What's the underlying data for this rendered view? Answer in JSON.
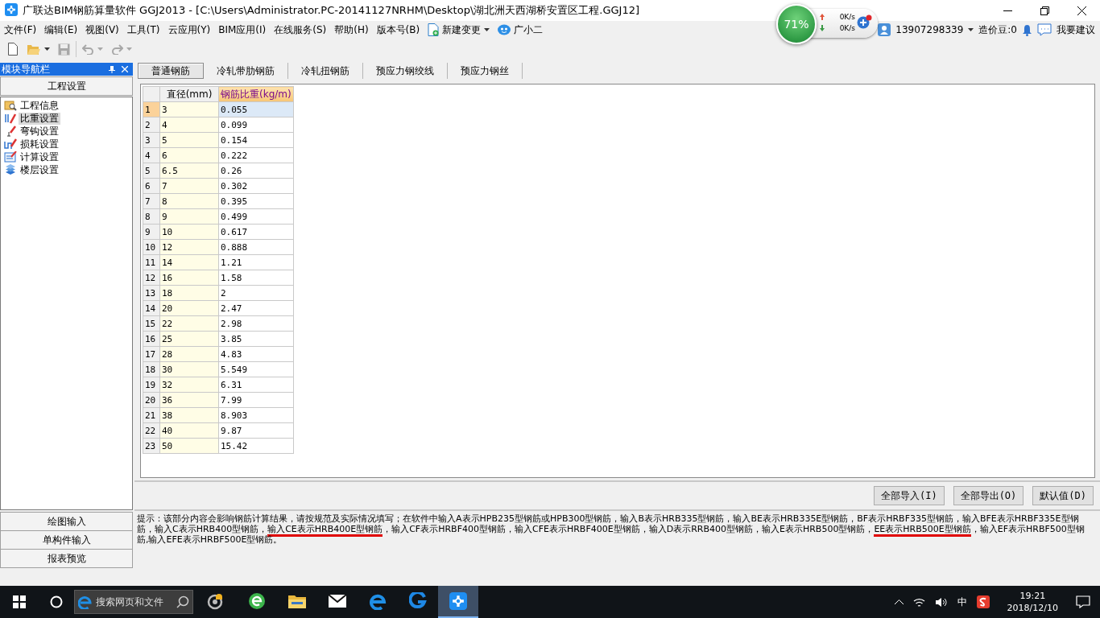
{
  "window": {
    "title": "广联达BIM钢筋算量软件 GGJ2013 - [C:\\Users\\Administrator.PC-20141127NRHM\\Desktop\\湖北洲天西湖桥安置区工程.GGJ12]"
  },
  "monitor": {
    "percent": "71%",
    "upload": "0K/s",
    "download": "0K/s"
  },
  "menu": [
    "文件(F)",
    "编辑(E)",
    "视图(V)",
    "工具(T)",
    "云应用(Y)",
    "BIM应用(I)",
    "在线服务(S)",
    "帮助(H)",
    "版本号(B)"
  ],
  "menu_extras": [
    {
      "label": "新建变更",
      "kind": "document"
    },
    {
      "label": "广小二",
      "kind": "mascot"
    }
  ],
  "account": {
    "phone": "13907298339",
    "beans": "造价豆:0",
    "feedback": "我要建议"
  },
  "toolbar": [
    {
      "kind": "new",
      "disabled": false,
      "dropdown": false
    },
    {
      "kind": "open",
      "disabled": false,
      "dropdown": true
    },
    {
      "kind": "save",
      "disabled": true,
      "dropdown": false
    },
    {
      "kind": "undo",
      "disabled": true,
      "dropdown": true
    },
    {
      "kind": "redo",
      "disabled": true,
      "dropdown": true
    }
  ],
  "nav": {
    "title": "模块导航栏",
    "section": "工程设置",
    "items": [
      {
        "label": "工程信息",
        "kind": "info",
        "selected": false
      },
      {
        "label": "比重设置",
        "kind": "weight",
        "selected": true
      },
      {
        "label": "弯钩设置",
        "kind": "hook",
        "selected": false
      },
      {
        "label": "损耗设置",
        "kind": "loss",
        "selected": false
      },
      {
        "label": "计算设置",
        "kind": "calc",
        "selected": false
      },
      {
        "label": "楼层设置",
        "kind": "floor",
        "selected": false
      }
    ],
    "footer": [
      "绘图输入",
      "单构件输入",
      "报表预览"
    ]
  },
  "tabs": [
    {
      "label": "普通钢筋",
      "selected": true
    },
    {
      "label": "冷轧带肋钢筋",
      "selected": false
    },
    {
      "label": "冷轧扭钢筋",
      "selected": false
    },
    {
      "label": "预应力钢绞线",
      "selected": false
    },
    {
      "label": "预应力钢丝",
      "selected": false
    }
  ],
  "table": {
    "columns": [
      {
        "label": "直径(mm)",
        "selected": false
      },
      {
        "label": "钢筋比重(kg/m)",
        "selected": true
      }
    ],
    "rows": [
      {
        "index": "1",
        "diameter": "3",
        "weight": "0.055",
        "selected": true
      },
      {
        "index": "2",
        "diameter": "4",
        "weight": "0.099",
        "selected": false
      },
      {
        "index": "3",
        "diameter": "5",
        "weight": "0.154",
        "selected": false
      },
      {
        "index": "4",
        "diameter": "6",
        "weight": "0.222",
        "selected": false
      },
      {
        "index": "5",
        "diameter": "6.5",
        "weight": "0.26",
        "selected": false
      },
      {
        "index": "6",
        "diameter": "7",
        "weight": "0.302",
        "selected": false
      },
      {
        "index": "7",
        "diameter": "8",
        "weight": "0.395",
        "selected": false
      },
      {
        "index": "8",
        "diameter": "9",
        "weight": "0.499",
        "selected": false
      },
      {
        "index": "9",
        "diameter": "10",
        "weight": "0.617",
        "selected": false
      },
      {
        "index": "10",
        "diameter": "12",
        "weight": "0.888",
        "selected": false
      },
      {
        "index": "11",
        "diameter": "14",
        "weight": "1.21",
        "selected": false
      },
      {
        "index": "12",
        "diameter": "16",
        "weight": "1.58",
        "selected": false
      },
      {
        "index": "13",
        "diameter": "18",
        "weight": "2",
        "selected": false
      },
      {
        "index": "14",
        "diameter": "20",
        "weight": "2.47",
        "selected": false
      },
      {
        "index": "15",
        "diameter": "22",
        "weight": "2.98",
        "selected": false
      },
      {
        "index": "16",
        "diameter": "25",
        "weight": "3.85",
        "selected": false
      },
      {
        "index": "17",
        "diameter": "28",
        "weight": "4.83",
        "selected": false
      },
      {
        "index": "18",
        "diameter": "30",
        "weight": "5.549",
        "selected": false
      },
      {
        "index": "19",
        "diameter": "32",
        "weight": "6.31",
        "selected": false
      },
      {
        "index": "20",
        "diameter": "36",
        "weight": "7.99",
        "selected": false
      },
      {
        "index": "21",
        "diameter": "38",
        "weight": "8.903",
        "selected": false
      },
      {
        "index": "22",
        "diameter": "40",
        "weight": "9.87",
        "selected": false
      },
      {
        "index": "23",
        "diameter": "50",
        "weight": "15.42",
        "selected": false
      }
    ]
  },
  "buttons": [
    "全部导入(I)",
    "全部导出(O)",
    "默认值(D)"
  ],
  "hint": [
    {
      "text": "提示：该部分内容会影响钢筋计算结果，请按规范及实际情况填写；在软件中输入A表示HPB235型钢筋或HPB300型钢筋，输入B表示HRB335型钢筋，输入BE表示HRB335E型钢筋，BF表示HRBF335型钢筋，输入BFE表示HRBF335E型钢筋，输入C表示HRB400型钢筋，",
      "underlined": false
    },
    {
      "text": "输入CE表示HRB400E型钢筋",
      "underlined": true
    },
    {
      "text": "，输入CF表示HRBF400型钢筋，输入CFE表示HRBF400E型钢筋，输入D表示RRB400型钢筋，输入E表示HRB500型钢筋，",
      "underlined": false
    },
    {
      "text": "EE表示HRB500E型钢筋",
      "underlined": true
    },
    {
      "text": "，输入EF表示HRBF500型钢筋,输入EFE表示HRBF500E型钢筋。",
      "underlined": false
    }
  ],
  "taskbar": {
    "search": "搜索网页和文件",
    "apps": [
      {
        "kind": "swirl",
        "selected": false
      },
      {
        "kind": "browser",
        "selected": false
      },
      {
        "kind": "folder",
        "selected": false
      },
      {
        "kind": "mail",
        "selected": false
      },
      {
        "kind": "edge",
        "selected": false
      },
      {
        "kind": "glodon",
        "selected": false
      },
      {
        "kind": "app",
        "selected": true
      }
    ],
    "ime": "中",
    "time": "19:21",
    "date": "2018/12/10"
  }
}
